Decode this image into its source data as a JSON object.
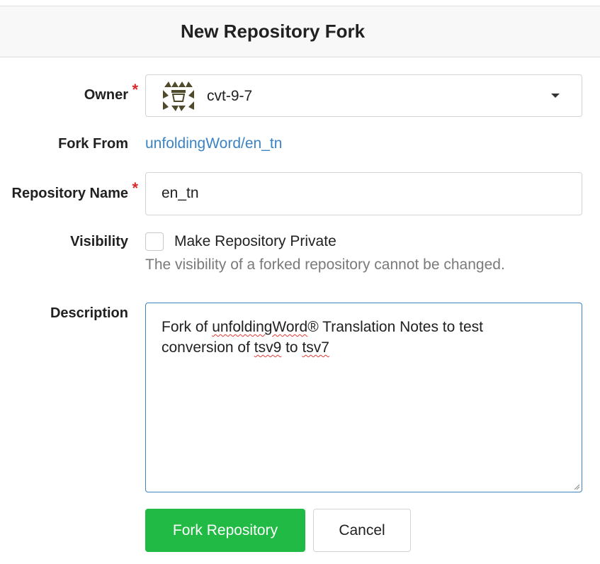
{
  "header": {
    "title": "New Repository Fork"
  },
  "form": {
    "owner": {
      "label": "Owner",
      "required_mark": "*",
      "value": "cvt-9-7",
      "avatar_icon": "identicon-avatar",
      "accent_color": "#4f4a2c"
    },
    "fork_from": {
      "label": "Fork From",
      "link_text": "unfoldingWord/en_tn"
    },
    "repo_name": {
      "label": "Repository Name",
      "required_mark": "*",
      "value": "en_tn"
    },
    "visibility": {
      "label": "Visibility",
      "checkbox_label": "Make Repository Private",
      "checked": false,
      "helper": "The visibility of a forked repository cannot be changed."
    },
    "description": {
      "label": "Description",
      "parts": [
        {
          "text": "Fork of ",
          "misspelled": false
        },
        {
          "text": "unfoldingWord",
          "misspelled": true
        },
        {
          "text": "® Translation Notes to test conversion of ",
          "misspelled": false
        },
        {
          "text": "tsv9",
          "misspelled": true
        },
        {
          "text": " to ",
          "misspelled": false
        },
        {
          "text": "tsv7",
          "misspelled": true
        }
      ]
    }
  },
  "buttons": {
    "submit": "Fork Repository",
    "cancel": "Cancel"
  },
  "colors": {
    "primary": "#21ba45",
    "link": "#3a83c4",
    "required": "#db2828"
  }
}
